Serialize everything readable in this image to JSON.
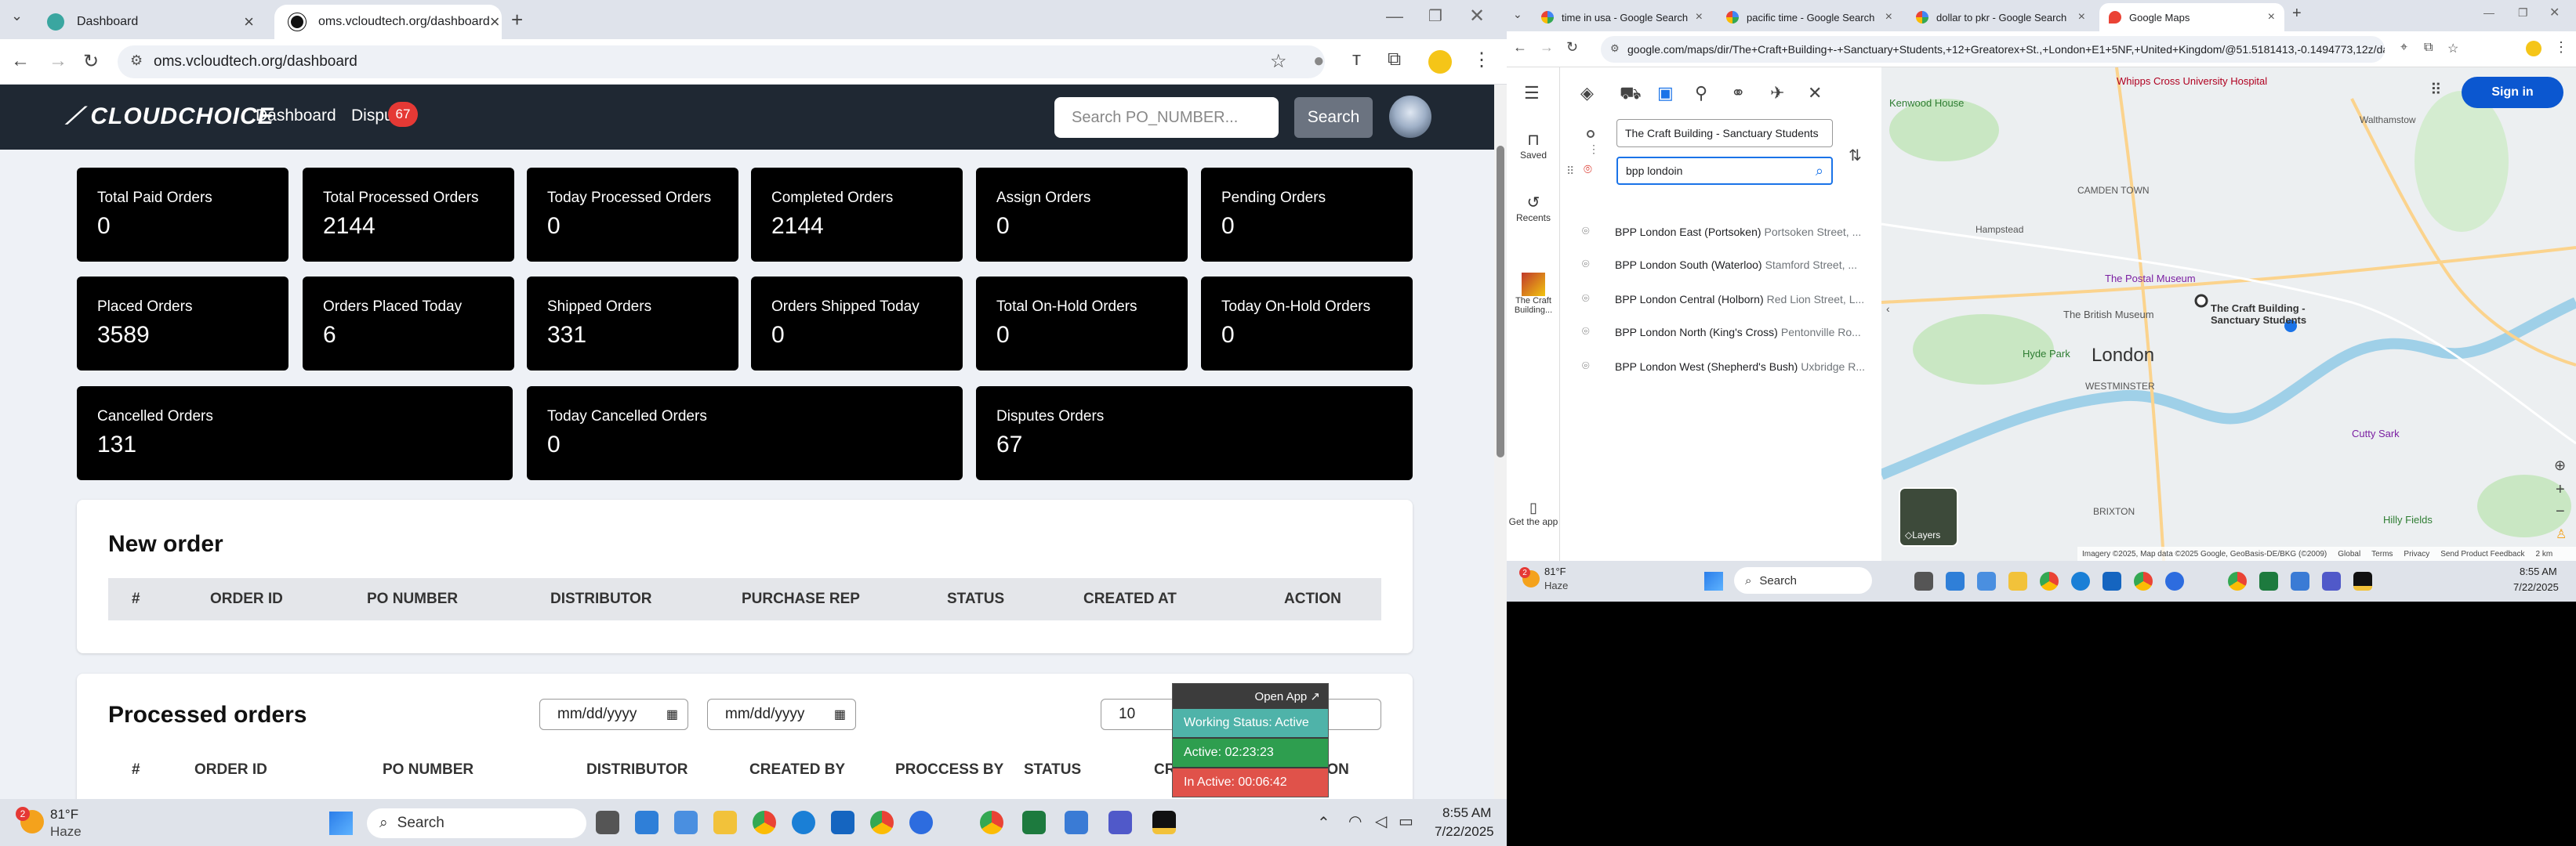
{
  "left_browser": {
    "tabs": [
      {
        "title": "Dashboard",
        "active": false
      },
      {
        "title": "oms.vcloudtech.org/dashboard",
        "active": true
      }
    ],
    "url": "oms.vcloudtech.org/dashboard",
    "site": {
      "logo": "CLOUDCHOICE",
      "nav": [
        {
          "label": "Dashboard"
        },
        {
          "label": "Dispu"
        }
      ],
      "disputes_badge": "67",
      "search_placeholder": "Search PO_NUMBER...",
      "search_button": "Search"
    },
    "cards": [
      {
        "label": "Total Paid Orders",
        "value": "0"
      },
      {
        "label": "Total Processed Orders",
        "value": "2144"
      },
      {
        "label": "Today Processed Orders",
        "value": "0"
      },
      {
        "label": "Completed Orders",
        "value": "2144"
      },
      {
        "label": "Assign Orders",
        "value": "0"
      },
      {
        "label": "Pending Orders",
        "value": "0"
      },
      {
        "label": "Placed Orders",
        "value": "3589"
      },
      {
        "label": "Orders Placed Today",
        "value": "6"
      },
      {
        "label": "Shipped Orders",
        "value": "331"
      },
      {
        "label": "Orders Shipped Today",
        "value": "0"
      },
      {
        "label": "Total On-Hold Orders",
        "value": "0"
      },
      {
        "label": "Today On-Hold Orders",
        "value": "0"
      },
      {
        "label": "Cancelled Orders",
        "value": "131"
      },
      {
        "label": "Today Cancelled Orders",
        "value": "0"
      },
      {
        "label": "Disputes Orders",
        "value": "67"
      }
    ],
    "new_order": {
      "title": "New order",
      "columns": [
        "#",
        "ORDER ID",
        "PO NUMBER",
        "DISTRIBUTOR",
        "PURCHASE REP",
        "STATUS",
        "CREATED AT",
        "ACTION"
      ]
    },
    "processed_orders": {
      "title": "Processed orders",
      "date_from": "mm/dd/yyyy",
      "date_to": "mm/dd/yyyy",
      "page_size": "10",
      "columns": [
        "#",
        "ORDER ID",
        "PO NUMBER",
        "DISTRIBUTOR",
        "CREATED BY",
        "PROCCESS BY",
        "STATUS",
        "CREATED AT",
        "ACTION"
      ]
    },
    "working_widget": {
      "open_app": "Open App ↗",
      "status": "Working Status: Active",
      "active": "Active: 02:23:23",
      "inactive": "In Active: 00:06:42"
    }
  },
  "taskbar_left": {
    "weather_temp": "81°F",
    "weather_desc": "Haze",
    "weather_badge": "2",
    "search": "Search",
    "time": "8:55 AM",
    "date": "7/22/2025"
  },
  "right_browser": {
    "tabs": [
      {
        "title": "time in usa - Google Search",
        "active": false
      },
      {
        "title": "pacific time - Google Search",
        "active": false
      },
      {
        "title": "dollar to pkr - Google Search",
        "active": false
      },
      {
        "title": "Google Maps",
        "active": true
      }
    ],
    "url": "google.com/maps/dir/The+Craft+Building+-+Sanctuary+Students,+12+Greatorex+St.,+London+E1+5NF,+United+Kingdom/@51.5181413,-0.1494773,12z/data=!4...",
    "rail": {
      "saved": "Saved",
      "recents": "Recents",
      "recent_place": "The Craft Building...",
      "get_app": "Get the app"
    },
    "origin": "The Craft Building - Sanctuary Students",
    "destination": "bpp londoin",
    "suggestions": [
      {
        "name": "BPP London East (Portsoken)",
        "address": "Portsoken Street, ..."
      },
      {
        "name": "BPP London South (Waterloo)",
        "address": "Stamford Street, ..."
      },
      {
        "name": "BPP London Central (Holborn)",
        "address": "Red Lion Street, L..."
      },
      {
        "name": "BPP London North (King's Cross)",
        "address": "Pentonville Ro..."
      },
      {
        "name": "BPP London West (Shepherd's Bush)",
        "address": "Uxbridge R..."
      }
    ],
    "map": {
      "sign_in": "Sign in",
      "layers": "Layers",
      "city": "London",
      "place_label": "The Craft Building - Sanctuary Students",
      "labels": [
        {
          "text": "Whipps Cross University Hospital"
        },
        {
          "text": "Kenwood House"
        },
        {
          "text": "CAMDEN TOWN"
        },
        {
          "text": "The Postal Museum"
        },
        {
          "text": "The British Museum"
        },
        {
          "text": "Hyde Park"
        },
        {
          "text": "WESTMINSTER"
        },
        {
          "text": "BRIXTON"
        },
        {
          "text": "Cutty Sark"
        },
        {
          "text": "Hilly Fields"
        },
        {
          "text": "Hampstead"
        },
        {
          "text": "Walthamstow"
        }
      ],
      "footer": [
        "Imagery ©2025, Map data ©2025 Google, GeoBasis-DE/BKG (©2009)",
        "Global",
        "Terms",
        "Privacy",
        "Send Product Feedback",
        "2 km"
      ]
    }
  },
  "taskbar_right": {
    "weather_temp": "81°F",
    "weather_desc": "Haze",
    "weather_badge": "2",
    "search": "Search",
    "time": "8:55 AM",
    "date": "7/22/2025"
  },
  "colors": {
    "nav_bg": "#1f2833",
    "card_bg": "#000000",
    "badge_red": "#e53935",
    "status_green": "#2e9e4f",
    "status_teal": "#4fb3a9",
    "inactive_red": "#e0524a",
    "map_water": "#9fd0e8"
  }
}
